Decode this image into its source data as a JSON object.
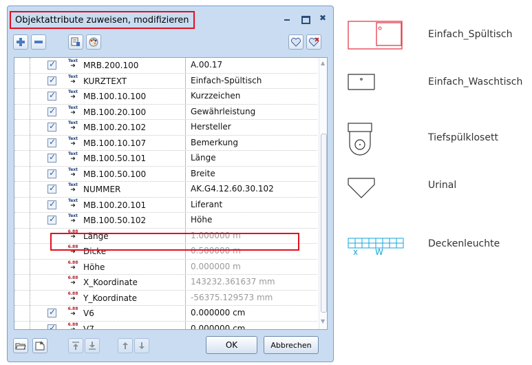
{
  "dialog": {
    "title": "Objektattribute zuweisen, modifizieren",
    "window_buttons": [
      "minimize",
      "maximize",
      "close"
    ],
    "toolbar": {
      "left_buttons": [
        "add-attribute-icon",
        "remove-attribute-icon",
        "edit-attribute-icon",
        "palette-icon"
      ],
      "right_buttons": [
        "favorite-heart-icon",
        "favorite-heart-remove-icon"
      ]
    },
    "rows": [
      {
        "checked": true,
        "type": "text",
        "name": "MRB.200.100",
        "value": "A.00.17",
        "value_gray": false
      },
      {
        "checked": true,
        "type": "text",
        "name": "KURZTEXT",
        "value": "Einfach-Spültisch",
        "value_gray": false
      },
      {
        "checked": true,
        "type": "text",
        "name": "MB.100.10.100",
        "value": "Kurzzeichen",
        "value_gray": false
      },
      {
        "checked": true,
        "type": "text",
        "name": "MB.100.20.100",
        "value": "Gewährleistung",
        "value_gray": false
      },
      {
        "checked": true,
        "type": "text",
        "name": "MB.100.20.102",
        "value": "Hersteller",
        "value_gray": false
      },
      {
        "checked": true,
        "type": "text",
        "name": "MB.100.10.107",
        "value": "Bemerkung",
        "value_gray": false
      },
      {
        "checked": true,
        "type": "text",
        "name": "MB.100.50.101",
        "value": "Länge",
        "value_gray": false
      },
      {
        "checked": true,
        "type": "text",
        "name": "MB.100.50.100",
        "value": "Breite",
        "value_gray": false
      },
      {
        "checked": true,
        "type": "text",
        "name": "NUMMER",
        "value": "AK.G4.12.60.30.102",
        "value_gray": false
      },
      {
        "checked": true,
        "type": "text",
        "name": "MB.100.20.101",
        "value": "Liferant",
        "value_gray": false
      },
      {
        "checked": true,
        "type": "text",
        "name": "MB.100.50.102",
        "value": "Höhe",
        "value_gray": false
      },
      {
        "checked": false,
        "type": "number",
        "name": "Länge",
        "value": "1.000000 m",
        "value_gray": true
      },
      {
        "checked": false,
        "type": "number",
        "name": "Dicke",
        "value": "0.500000 m",
        "value_gray": true
      },
      {
        "checked": false,
        "type": "number",
        "name": "Höhe",
        "value": "0.000000 m",
        "value_gray": true
      },
      {
        "checked": false,
        "type": "number",
        "name": "X_Koordinate",
        "value": "143232.361637 mm",
        "value_gray": true
      },
      {
        "checked": false,
        "type": "number",
        "name": "Y_Koordinate",
        "value": "-56375.129573 mm",
        "value_gray": true
      },
      {
        "checked": true,
        "type": "number",
        "name": "V6",
        "value": "0.000000 cm",
        "value_gray": false
      },
      {
        "checked": true,
        "type": "number",
        "name": "V7",
        "value": "0.000000 cm",
        "value_gray": false
      }
    ],
    "type_icon_labels": {
      "text": "Text",
      "number": "6.88"
    },
    "highlighted_row": "NUMMER",
    "bottom": {
      "left_buttons": [
        "open-folder-icon",
        "save-favorite-icon",
        "move-top-icon",
        "move-bottom-icon",
        "move-up-icon",
        "move-down-icon"
      ],
      "ok_label": "OK",
      "cancel_label": "Abbrechen"
    }
  },
  "legend": [
    {
      "label": "Einfach_Spültisch",
      "symbol": "sink-symbol-icon"
    },
    {
      "label": "Einfach_Waschtisch",
      "symbol": "washbasin-symbol-icon"
    },
    {
      "label": "Tiefspülklosett",
      "symbol": "toilet-symbol-icon"
    },
    {
      "label": "Urinal",
      "symbol": "urinal-symbol-icon"
    },
    {
      "label": "Deckenleuchte",
      "symbol": "ceiling-light-symbol-icon",
      "sub_labels": [
        "x",
        "W"
      ]
    }
  ],
  "colors": {
    "highlight_red": "#e0101e",
    "dialog_bg": "#c9dcf1",
    "legend_cyan": "#12a6d9"
  }
}
